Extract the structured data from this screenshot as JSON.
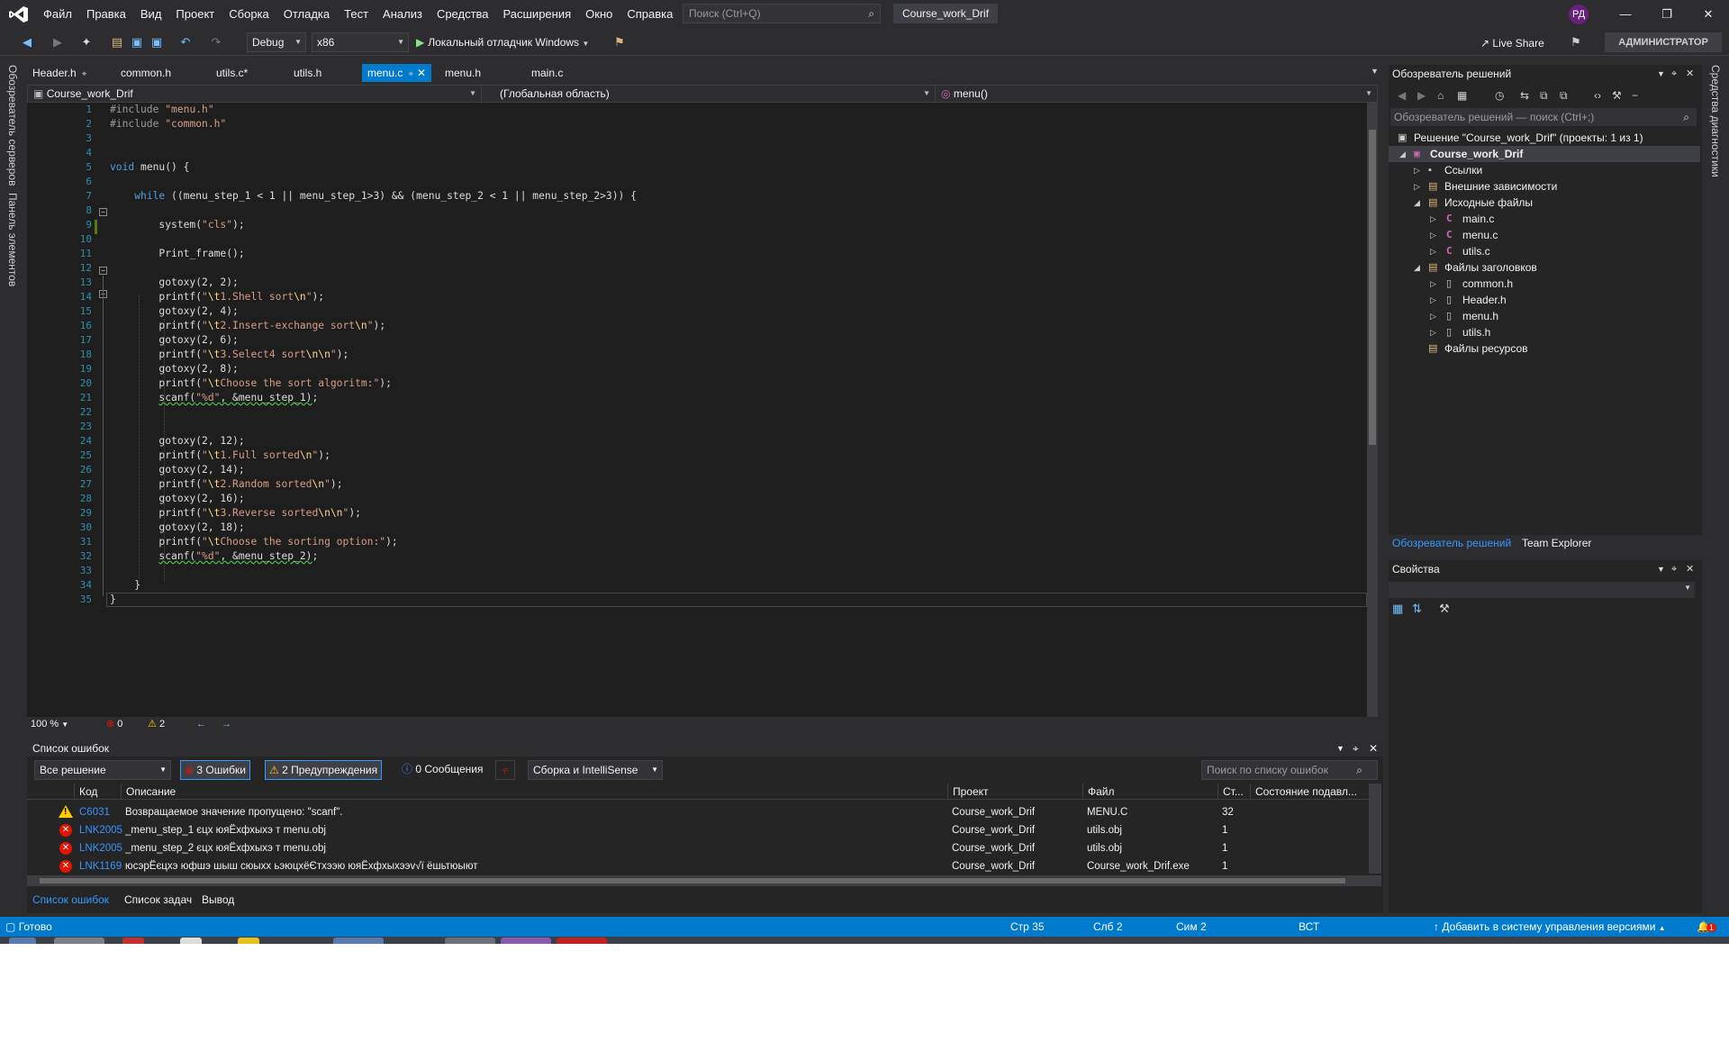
{
  "menubar": {
    "items": [
      "Файл",
      "Правка",
      "Вид",
      "Проект",
      "Сборка",
      "Отладка",
      "Тест",
      "Анализ",
      "Средства",
      "Расширения",
      "Окно",
      "Справка"
    ],
    "search_placeholder": "Поиск (Ctrl+Q)",
    "solution_title": "Course_work_Drif",
    "avatar_initials": "РД"
  },
  "toolbar": {
    "config": "Debug",
    "platform": "x86",
    "run_label": "Локальный отладчик Windows",
    "live_share": "Live Share",
    "admin_label": "АДМИНИСТРАТОР"
  },
  "left_strip": {
    "server_explorer": "Обозреватель серверов",
    "toolbox": "Панель элементов"
  },
  "right_strip": {
    "diagnostics": "Средства диагностики"
  },
  "tabs": [
    {
      "label": "Header.h",
      "pinned": true,
      "active": false
    },
    {
      "label": "common.h",
      "pinned": false,
      "active": false
    },
    {
      "label": "utils.c*",
      "pinned": false,
      "active": false
    },
    {
      "label": "utils.h",
      "pinned": false,
      "active": false
    },
    {
      "label": "menu.c",
      "pinned": true,
      "active": true
    },
    {
      "label": "menu.h",
      "pinned": false,
      "active": false
    },
    {
      "label": "main.c",
      "pinned": false,
      "active": false
    }
  ],
  "navbar": {
    "project": "Course_work_Drif",
    "scope": "(Глобальная область)",
    "member": "menu()"
  },
  "editor": {
    "line_numbers": [
      "1",
      "2",
      "3",
      "4",
      "5",
      "6",
      "7",
      "8",
      "9",
      "10",
      "11",
      "12",
      "13",
      "14",
      "15",
      "16",
      "17",
      "18",
      "19",
      "20",
      "21",
      "22",
      "23",
      "24",
      "25",
      "26",
      "27",
      "28",
      "29",
      "30",
      "31",
      "32",
      "33",
      "34",
      "35"
    ],
    "zoom": "100 %",
    "error_count": "0",
    "warning_count": "2"
  },
  "error_list": {
    "title": "Список ошибок",
    "scope_combo": "Все решение",
    "errors_btn": "3 Ошибки",
    "warnings_btn": "2 Предупреждения",
    "messages_btn": "0 Сообщения",
    "build_combo": "Сборка и IntelliSense",
    "search_placeholder": "Поиск по списку ошибок",
    "columns": [
      "Код",
      "Описание",
      "Проект",
      "Файл",
      "Ст...",
      "Состояние подавл..."
    ],
    "rows": [
      {
        "type": "warning",
        "code": "C6031",
        "desc": "Возвращаемое значение пропущено: \"scanf\".",
        "project": "Course_work_Drif",
        "file": "MENU.C",
        "line": "32"
      },
      {
        "type": "error",
        "code": "LNK2005",
        "desc": "_menu_step_1 єцх юяЁхфхыхэ т menu.obj",
        "project": "Course_work_Drif",
        "file": "utils.obj",
        "line": "1"
      },
      {
        "type": "error",
        "code": "LNK2005",
        "desc": "_menu_step_2 єцх юяЁхфхыхэ т menu.obj",
        "project": "Course_work_Drif",
        "file": "utils.obj",
        "line": "1"
      },
      {
        "type": "error",
        "code": "LNK1169",
        "desc": "юсэрЁєцхэ юфшэ шыш сюыхх ьэюцхёЄтхээю юяЁхфхыхээv√ї ёшьтюыют",
        "project": "Course_work_Drif",
        "file": "Course_work_Drif.exe",
        "line": "1"
      }
    ],
    "bottom_tabs": [
      "Список ошибок",
      "Список задач",
      "Вывод"
    ]
  },
  "solution_explorer": {
    "title": "Обозреватель решений",
    "search_placeholder": "Обозреватель решений — поиск (Ctrl+;)",
    "solution_label": "Решение \"Course_work_Drif\" (проекты: 1 из 1)",
    "project": "Course_work_Drif",
    "refs": "Ссылки",
    "ext_deps": "Внешние зависимости",
    "src_folder": "Исходные файлы",
    "src_files": [
      "main.c",
      "menu.c",
      "utils.c"
    ],
    "hdr_folder": "Файлы заголовков",
    "hdr_files": [
      "common.h",
      "Header.h",
      "menu.h",
      "utils.h"
    ],
    "res_folder": "Файлы ресурсов",
    "tab_solution": "Обозреватель решений",
    "tab_team": "Team Explorer"
  },
  "properties": {
    "title": "Свойства"
  },
  "statusbar": {
    "ready": "Готово",
    "line": "Стр 35",
    "col": "Слб 2",
    "ch": "Сим 2",
    "mode": "ВСТ",
    "vcs": "Добавить в систему управления версиями",
    "notifications": "1"
  }
}
